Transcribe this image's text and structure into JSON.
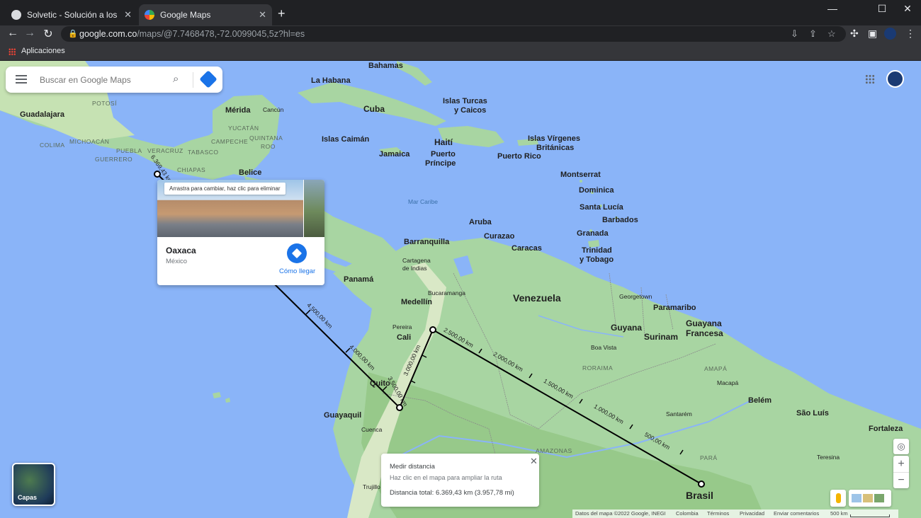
{
  "browser": {
    "tabs": [
      {
        "label": "Solvetic - Solución a los problem",
        "close": "✕"
      },
      {
        "label": "Google Maps",
        "close": "✕"
      }
    ],
    "new_tab": "+",
    "window_controls": {
      "minimize": "—",
      "maximize": "☐",
      "close": "✕"
    },
    "url_host": "google.com.co",
    "url_path": "/maps/@7.7468478,-72.0099045,5z?hl=es",
    "bookmark": "Aplicaciones"
  },
  "search": {
    "placeholder": "Buscar en Google Maps"
  },
  "place_card": {
    "tooltip": "Arrastra para cambiar, haz clic para eliminar",
    "name": "Oaxaca",
    "subtitle": "México",
    "directions_link": "Cómo llegar"
  },
  "measure": {
    "title": "Medir distancia",
    "hint": "Haz clic en el mapa para ampliar la ruta",
    "total": "Distancia total: 6.369,43 km (3.957,78 mi)",
    "close": "✕"
  },
  "layers": {
    "label": "Capas"
  },
  "map_controls": {
    "zoom_in": "+",
    "zoom_out": "−"
  },
  "footer": {
    "items": [
      "Datos del mapa ©2022 Google, INEGI",
      "Colombia",
      "Términos",
      "Privacidad",
      "Enviar comentarios",
      "500 km"
    ]
  },
  "map_labels": {
    "bahamas": "Bahamas",
    "la_habana": "La Habana",
    "cuba": "Cuba",
    "islas_turcas": "Islas Turcas",
    "y_caicos": "y Caicos",
    "guadalajara": "Guadalajara",
    "merida": "Mérida",
    "cancun": "Cancún",
    "potosi": "POTOSÍ",
    "yucatan": "YUCATÁN",
    "quintana": "QUINTANA",
    "roo": "ROO",
    "colima": "COLIMA",
    "michoacan": "MICHOACÁN",
    "campeche": "CAMPECHE",
    "puebla": "PUEBLA",
    "veracruz": "VERACRUZ",
    "tabasco": "TABASCO",
    "guerrero": "GUERRERO",
    "chiapas": "CHIAPAS",
    "belice": "Belice",
    "islas_caiman": "Islas Caimán",
    "haiti": "Haití",
    "jamaica": "Jamaica",
    "puerto_principe_1": "Puerto",
    "puerto_principe_2": "Príncipe",
    "puerto_rico": "Puerto Rico",
    "islas_virgenes": "Islas Vírgenes",
    "britanicas": "Británicas",
    "montserrat": "Montserrat",
    "dominica": "Dominica",
    "santa_lucia": "Santa Lucía",
    "barbados": "Barbados",
    "granada": "Granada",
    "trinidad": "Trinidad",
    "y_tobago": "y Tobago",
    "mar_caribe": "Mar Caribe",
    "aruba": "Aruba",
    "curazao": "Curazao",
    "barranquilla": "Barranquilla",
    "caracas": "Caracas",
    "cartagena_1": "Cartagena",
    "cartagena_2": "de Indias",
    "panama": "Panamá",
    "bucaramanga": "Bucaramanga",
    "venezuela": "Venezuela",
    "medellin": "Medellín",
    "georgetown": "Georgetown",
    "paramaribo": "Paramaribo",
    "guyana": "Guyana",
    "guyana_francesa_1": "Guayana",
    "guyana_francesa_2": "Francesa",
    "surinam": "Surinam",
    "pereira": "Pereira",
    "cali": "Cali",
    "boa_vista": "Boa Vista",
    "roraima": "RORAIMA",
    "amapa": "AMAPÁ",
    "macapa": "Macapá",
    "quito": "Quito",
    "guayaquil": "Guayaquil",
    "cuenca": "Cuenca",
    "belem": "Belém",
    "sao_luis": "São Luís",
    "santarem": "Santarém",
    "fortaleza": "Fortaleza",
    "amazonas": "AMAZONAS",
    "para": "PARÁ",
    "teresina": "Teresina",
    "trujillo": "Trujillo",
    "brasil": "Brasil"
  },
  "route": {
    "distance_labels": [
      "6.369,43 km",
      "4.500,00 km",
      "4.000,00 km",
      "3.500,00 km",
      "3.000,00 km",
      "2.500,00 km",
      "2.000,00 km",
      "1.500,00 km",
      "1.000,00 km",
      "500,00 km"
    ]
  }
}
